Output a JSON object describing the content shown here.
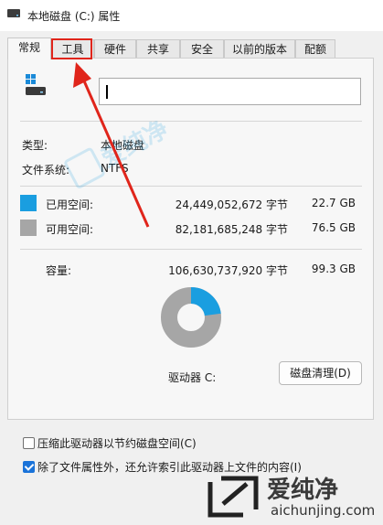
{
  "window": {
    "title": "本地磁盘 (C:) 属性"
  },
  "tabs": [
    {
      "label": "常规",
      "active": true
    },
    {
      "label": "工具",
      "active": false,
      "highlighted": true
    },
    {
      "label": "硬件",
      "active": false
    },
    {
      "label": "共享",
      "active": false
    },
    {
      "label": "安全",
      "active": false
    },
    {
      "label": "以前的版本",
      "active": false
    },
    {
      "label": "配额",
      "active": false
    }
  ],
  "general": {
    "drive_name_value": "",
    "type_label": "类型:",
    "type_value": "本地磁盘",
    "fs_label": "文件系统:",
    "fs_value": "NTFS",
    "used": {
      "label": "已用空间:",
      "bytes": "24,449,052,672 字节",
      "size": "22.7 GB",
      "color": "#1a9ee0"
    },
    "free": {
      "label": "可用空间:",
      "bytes": "82,181,685,248 字节",
      "size": "76.5 GB",
      "color": "#a6a6a6"
    },
    "capacity": {
      "label": "容量:",
      "bytes": "106,630,737,920 字节",
      "size": "99.3 GB"
    },
    "used_fraction": 0.229,
    "drive_label": "驱动器 C:",
    "cleanup_button": "磁盘清理(D)",
    "compress_label": "压缩此驱动器以节约磁盘空间(C)",
    "compress_checked": false,
    "index_label": "除了文件属性外，还允许索引此驱动器上文件的内容(I)",
    "index_checked": true
  },
  "annotation": {
    "color": "#e0251b"
  },
  "watermark": {
    "brand": "爱纯净",
    "url": "aichunjing.com"
  }
}
